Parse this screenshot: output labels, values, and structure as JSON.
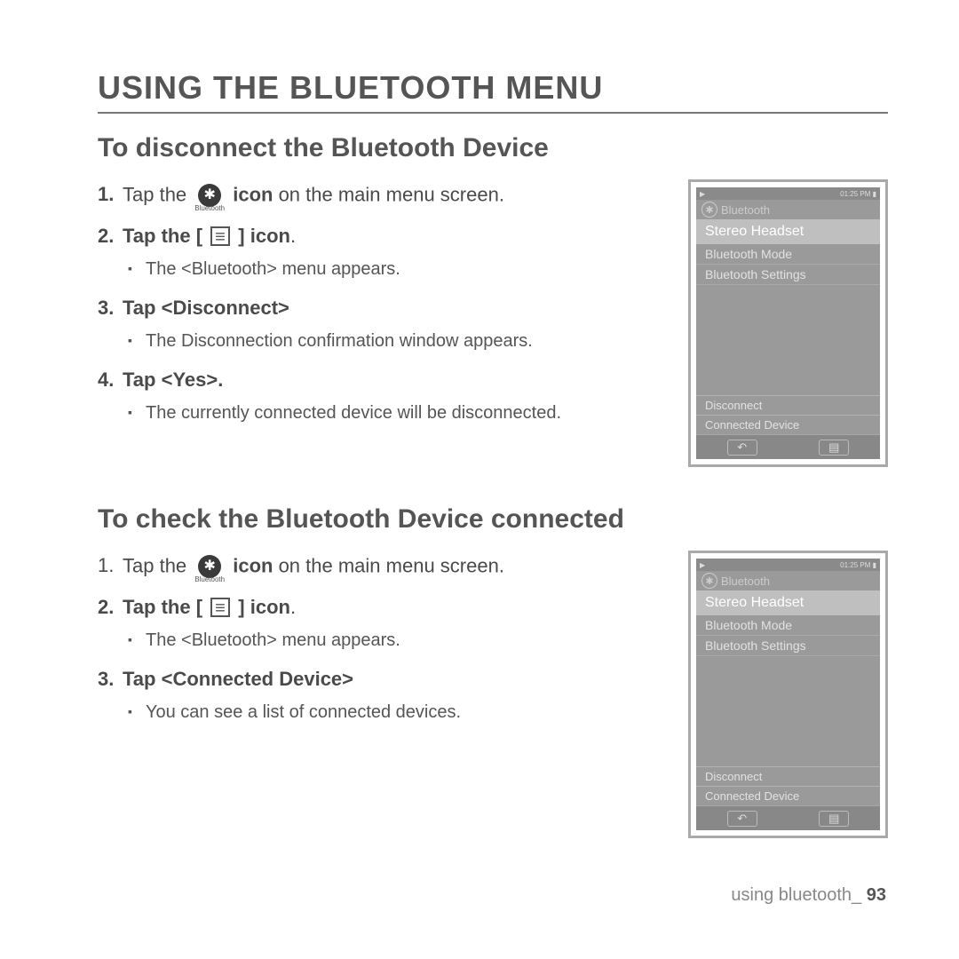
{
  "page_title": "USING THE BLUETOOTH MENU",
  "footer": {
    "chapter": "using bluetooth_",
    "page": "93"
  },
  "icon_labels": {
    "bluetooth": "Bluetooth"
  },
  "sections": [
    {
      "heading": "To disconnect the Bluetooth Device",
      "steps": [
        {
          "pre": "Tap the ",
          "bold_post": " icon",
          "post": " on the main menu screen.",
          "icon": "bt",
          "num_bold": true
        },
        {
          "pre": "Tap the ",
          "bold_pre": true,
          "bold_post": " icon",
          "post": ".",
          "icon": "menu",
          "sub": [
            "The <Bluetooth> menu appears."
          ]
        },
        {
          "text": "Tap <Disconnect>",
          "bold_all": true,
          "sub": [
            "The Disconnection confirmation window appears."
          ]
        },
        {
          "text": "Tap <Yes>.",
          "bold_all": true,
          "sub": [
            "The currently connected device will be disconnected."
          ]
        }
      ]
    },
    {
      "heading": "To check the Bluetooth Device connected",
      "steps": [
        {
          "pre": "Tap the ",
          "bold_post": " icon",
          "post": " on the main menu screen.",
          "icon": "bt",
          "num_bold": false
        },
        {
          "pre": "Tap the ",
          "bold_pre": true,
          "bold_post": " icon",
          "post": ".",
          "icon": "menu",
          "sub": [
            "The <Bluetooth> menu appears."
          ]
        },
        {
          "text": "Tap <Connected Device>",
          "bold_all": true,
          "sub": [
            "You can see a list of connected devices."
          ]
        }
      ]
    }
  ],
  "device": {
    "status_time": "01:25 PM",
    "title": "Bluetooth",
    "highlight": "Stereo Headset",
    "rows": [
      "Bluetooth Mode",
      "Bluetooth Settings"
    ],
    "bottom": [
      "Disconnect",
      "Connected Device"
    ]
  }
}
